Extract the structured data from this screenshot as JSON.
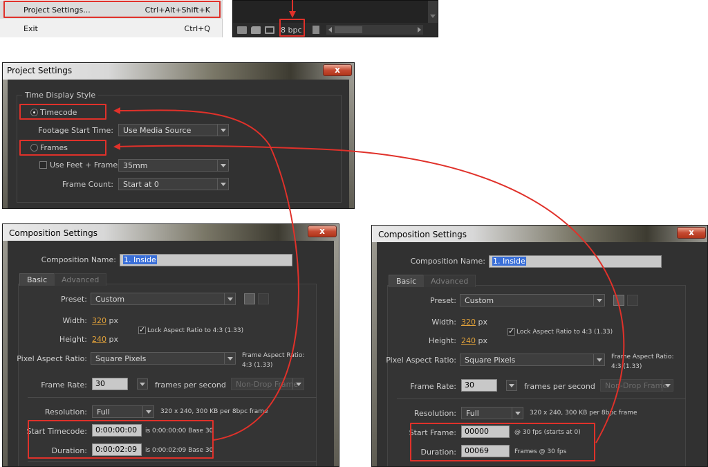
{
  "file_menu": {
    "items": [
      {
        "label": "Project Settings...",
        "shortcut": "Ctrl+Alt+Shift+K"
      },
      {
        "label": "Exit",
        "shortcut": "Ctrl+Q"
      }
    ]
  },
  "project_panel": {
    "bit_depth": "8 bpc"
  },
  "project_settings": {
    "title": "Project Settings",
    "close": "x",
    "group_label": "Time Display Style",
    "timecode_label": "Timecode",
    "footage_start_label": "Footage Start Time:",
    "footage_start_value": "Use Media Source",
    "frames_label": "Frames",
    "feet_frames_label": "Use Feet + Frames:",
    "feet_frames_value": "35mm",
    "frame_count_label": "Frame Count:",
    "frame_count_value": "Start at 0"
  },
  "comp_left": {
    "title": "Composition Settings",
    "close": "x",
    "name_label": "Composition Name:",
    "name_value": "1. Inside",
    "tabs": [
      "Basic",
      "Advanced"
    ],
    "preset_label": "Preset:",
    "preset_value": "Custom",
    "width_label": "Width:",
    "width_value": "320",
    "px": "px",
    "height_label": "Height:",
    "height_value": "240",
    "lock_label": "Lock Aspect Ratio to 4:3 (1.33)",
    "par_label": "Pixel Aspect Ratio:",
    "par_value": "Square Pixels",
    "far_label": "Frame Aspect Ratio:",
    "far_value": "4:3 (1.33)",
    "fps_label": "Frame Rate:",
    "fps_value": "30",
    "fps_unit": "frames per second",
    "drop_value": "Non-Drop Frame",
    "res_label": "Resolution:",
    "res_value": "Full",
    "res_info": "320 x 240, 300 KB per 8bpc frame",
    "start_label": "Start Timecode:",
    "start_value": "0:00:00:00",
    "start_info": "is 0:00:00:00  Base 30",
    "dur_label": "Duration:",
    "dur_value": "0:00:02:09",
    "dur_info": "is 0:00:02:09  Base 30"
  },
  "comp_right": {
    "title": "Composition Settings",
    "close": "x",
    "name_label": "Composition Name:",
    "name_value": "1. Inside",
    "tabs": [
      "Basic",
      "Advanced"
    ],
    "preset_label": "Preset:",
    "preset_value": "Custom",
    "width_label": "Width:",
    "width_value": "320",
    "px": "px",
    "height_label": "Height:",
    "height_value": "240",
    "lock_label": "Lock Aspect Ratio to 4:3 (1.33)",
    "par_label": "Pixel Aspect Ratio:",
    "par_value": "Square Pixels",
    "far_label": "Frame Aspect Ratio:",
    "far_value": "4:3 (1.33)",
    "fps_label": "Frame Rate:",
    "fps_value": "30",
    "fps_unit": "frames per second",
    "drop_value": "Non-Drop Frame",
    "res_label": "Resolution:",
    "res_value": "Full",
    "res_info": "320 x 240, 300 KB per 8bpc frame",
    "start_label": "Start Frame:",
    "start_value": "00000",
    "start_info": "@ 30 fps (starts at 0)",
    "dur_label": "Duration:",
    "dur_value": "00069",
    "dur_info": "Frames @ 30 fps"
  },
  "colors": {
    "highlight_red": "#e0312a",
    "dialog_bg": "#313131",
    "link_orange": "#e2a23a"
  }
}
